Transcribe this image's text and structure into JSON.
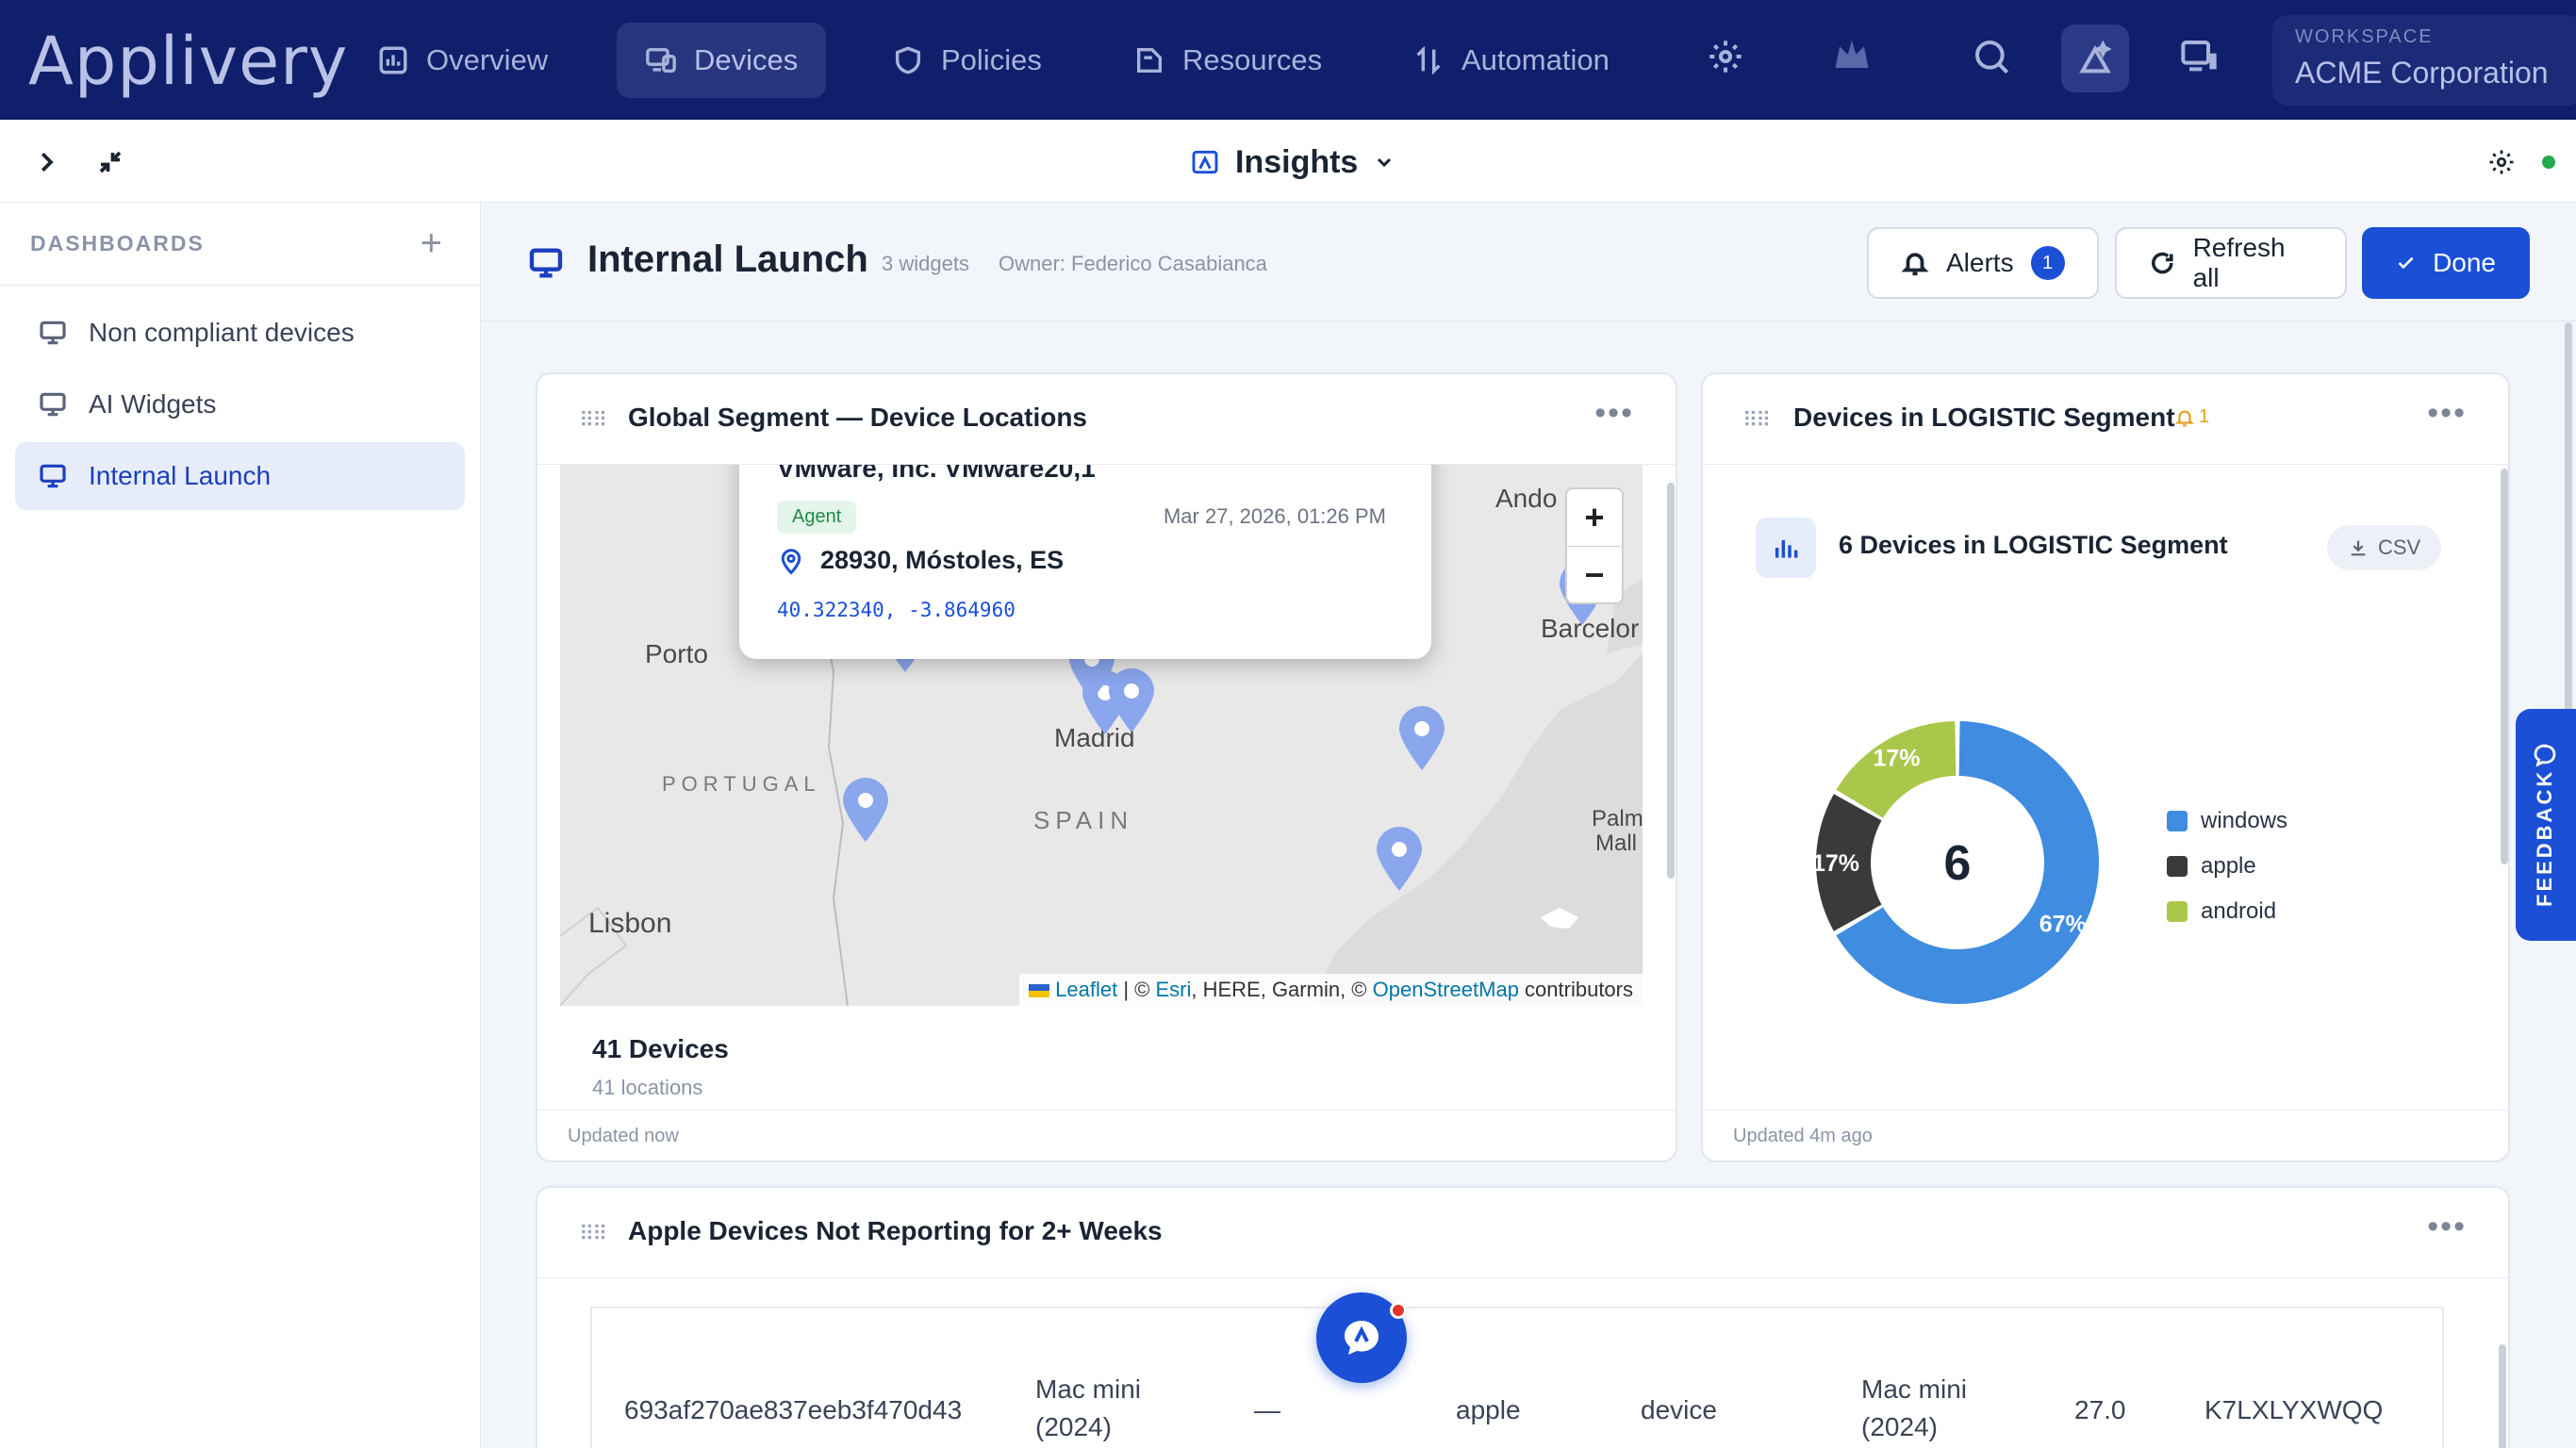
{
  "app": {
    "logo": "Applivery",
    "nav": [
      {
        "label": "Overview",
        "icon": "chart-icon"
      },
      {
        "label": "Devices",
        "icon": "devices-icon",
        "active": true
      },
      {
        "label": "Policies",
        "icon": "shield-icon"
      },
      {
        "label": "Resources",
        "icon": "folder-icon"
      },
      {
        "label": "Automation",
        "icon": "automation-icon"
      }
    ],
    "workspace": {
      "label": "WORKSPACE",
      "name": "ACME Corporation"
    }
  },
  "subheader": {
    "title": "Insights"
  },
  "sidebar": {
    "title": "DASHBOARDS",
    "items": [
      {
        "label": "Non compliant devices"
      },
      {
        "label": "AI Widgets"
      },
      {
        "label": "Internal Launch",
        "active": true
      }
    ]
  },
  "dashboard": {
    "title": "Internal Launch",
    "widget_count": "3 widgets",
    "owner": "Owner: Federico Casabianca",
    "alerts_label": "Alerts",
    "alerts_count": "1",
    "refresh_label": "Refresh all",
    "done_label": "Done"
  },
  "map_widget": {
    "title": "Global Segment — Device Locations",
    "labels": {
      "porto": "Porto",
      "portugal": "PORTUGAL",
      "spain": "SPAIN",
      "lisbon": "Lisbon",
      "madrid": "Madrid",
      "andorra": "Ando",
      "barcelona": "Barcelor",
      "palma1": "Palm",
      "palma2": "Mall"
    },
    "popup": {
      "title": "VMware, Inc. VMware20,1",
      "badge": "Agent",
      "date": "Mar 27, 2026, 01:26 PM",
      "location": "28930, Móstoles, ES",
      "coords": "40.322340, -3.864960"
    },
    "attribution": {
      "leaflet": "Leaflet",
      "sep1": " | © ",
      "esri": "Esri",
      "mid": ", HERE, Garmin, © ",
      "osm": "OpenStreetMap",
      "end": " contributors"
    },
    "summary_count": "41 Devices",
    "summary_sub": "41 locations",
    "updated": "Updated now"
  },
  "donut_widget": {
    "title": "Devices in LOGISTIC Segment",
    "alert_count": "1",
    "card_title": "6 Devices in LOGISTIC Segment",
    "csv_label": "CSV",
    "updated": "Updated 4m ago"
  },
  "chart_data": {
    "type": "pie",
    "title": "6 Devices in LOGISTIC Segment",
    "center_value": "6",
    "categories": [
      "windows",
      "apple",
      "android"
    ],
    "values": [
      4,
      1,
      1
    ],
    "percent_labels": [
      "67%",
      "17%",
      "17%"
    ],
    "colors": [
      "#3f8ce0",
      "#3a3a3a",
      "#a9c74b"
    ],
    "legend": "right"
  },
  "table_widget": {
    "title": "Apple Devices Not Reporting for 2+ Weeks",
    "row": [
      "693af270ae837eeb3f470d43",
      "Mac mini (2024)",
      "—",
      "apple",
      "device",
      "Mac mini (2024)",
      "27.0",
      "K7LXLYXWQQ"
    ]
  },
  "feedback_label": "FEEDBACK"
}
